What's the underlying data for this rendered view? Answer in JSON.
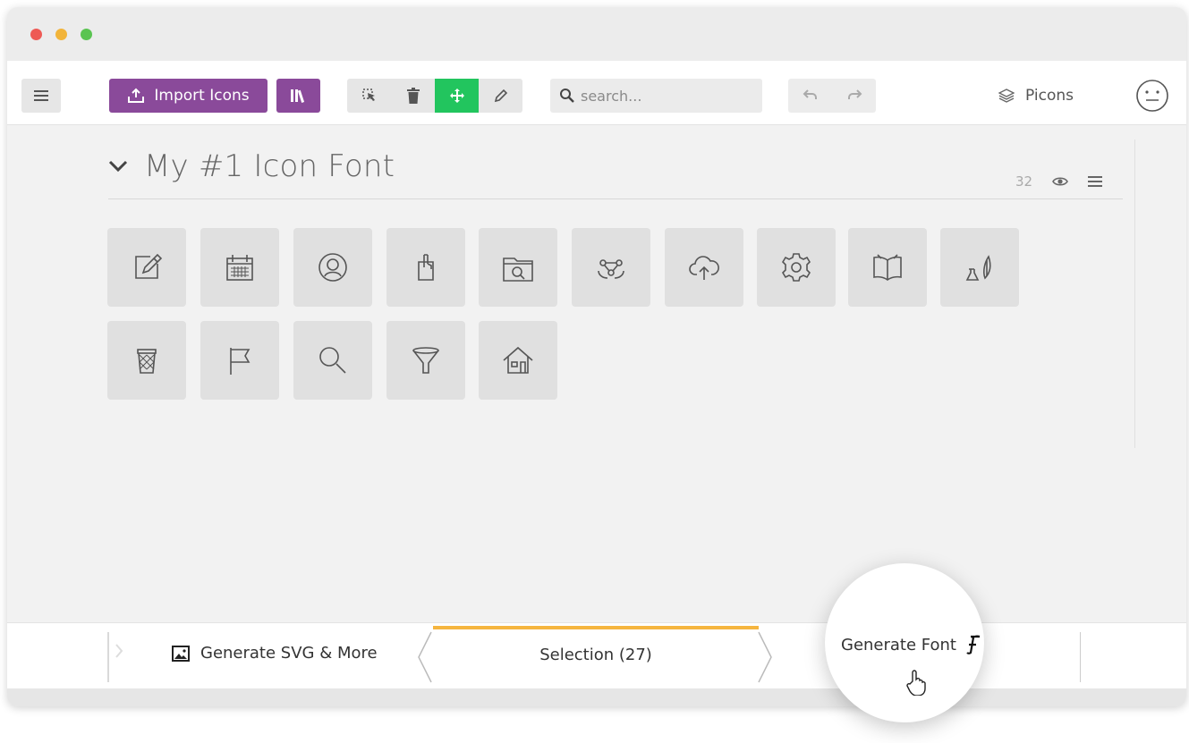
{
  "colors": {
    "accent_purple": "#8a4a9a",
    "tool_active_green": "#22c55e",
    "selection_border": "#f5b53f",
    "traffic_red": "#ee5a55",
    "traffic_yellow": "#f2b43a",
    "traffic_green": "#5ac451"
  },
  "toolbar": {
    "menu_icon": "hamburger-icon",
    "import_label": "Import Icons",
    "library_icon": "library-icon",
    "tools": [
      "select-pointer-icon",
      "trash-icon",
      "move-icon",
      "pencil-icon"
    ],
    "active_tool": "move-icon",
    "search": {
      "placeholder": "search...",
      "value": ""
    },
    "undo_icon": "undo-icon",
    "redo_icon": "redo-icon",
    "project_label": "Picons",
    "avatar_icon": "smiley-face-icon"
  },
  "section": {
    "title": "My #1 Icon Font",
    "count": "32",
    "collapse_icon": "chevron-down-icon",
    "visibility_icon": "eye-icon",
    "menu_icon": "hamburger-icon"
  },
  "icons": [
    {
      "name": "edit-icon",
      "selected": true
    },
    {
      "name": "calendar-icon",
      "selected": true
    },
    {
      "name": "user-circle-icon",
      "selected": true
    },
    {
      "name": "clipboard-touch-icon",
      "selected": true
    },
    {
      "name": "folder-search-icon",
      "selected": true
    },
    {
      "name": "network-icon",
      "selected": true
    },
    {
      "name": "cloud-upload-icon",
      "selected": true
    },
    {
      "name": "gear-icon",
      "selected": true
    },
    {
      "name": "open-book-icon",
      "selected": false
    },
    {
      "name": "flask-feather-icon",
      "selected": false
    },
    {
      "name": "trash-bin-icon",
      "selected": false
    },
    {
      "name": "flag-icon",
      "selected": false
    },
    {
      "name": "magnifier-icon",
      "selected": false
    },
    {
      "name": "funnel-icon",
      "selected": false
    },
    {
      "name": "home-icon",
      "selected": false
    }
  ],
  "bottom_bar": {
    "generate_svg_label": "Generate SVG & More",
    "selection_label": "Selection (27)",
    "generate_font_label": "Generate Font"
  }
}
